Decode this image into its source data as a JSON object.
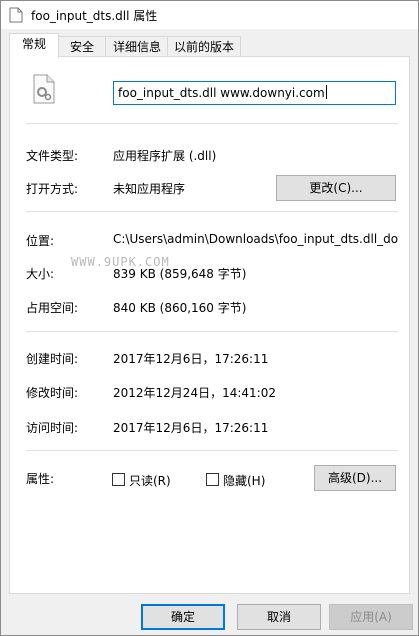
{
  "window": {
    "title": "foo_input_dts.dll 属性"
  },
  "tabs": [
    {
      "label": "常规"
    },
    {
      "label": "安全"
    },
    {
      "label": "详细信息"
    },
    {
      "label": "以前的版本"
    }
  ],
  "general": {
    "file_name": "foo_input_dts.dll www.downyi.com",
    "file_type_label": "文件类型:",
    "file_type_value": "应用程序扩展 (.dll)",
    "open_with_label": "打开方式:",
    "open_with_value": "未知应用程序",
    "change_button": "更改(C)...",
    "location_label": "位置:",
    "location_value": "C:\\Users\\admin\\Downloads\\foo_input_dts.dll_dow",
    "size_label": "大小:",
    "size_value": "839 KB (859,648 字节)",
    "size_on_disk_label": "占用空间:",
    "size_on_disk_value": "840 KB (860,160 字节)",
    "created_label": "创建时间:",
    "created_value": "2017年12月6日，17:26:11",
    "modified_label": "修改时间:",
    "modified_value": "2012年12月24日，14:41:02",
    "accessed_label": "访问时间:",
    "accessed_value": "2017年12月6日，17:26:11",
    "attributes_label": "属性:",
    "readonly_label": "只读(R)",
    "hidden_label": "隐藏(H)",
    "advanced_button": "高级(D)..."
  },
  "watermark": "WWW.9UPK.COM",
  "footer": {
    "ok": "确定",
    "cancel": "取消",
    "apply": "应用(A)"
  }
}
